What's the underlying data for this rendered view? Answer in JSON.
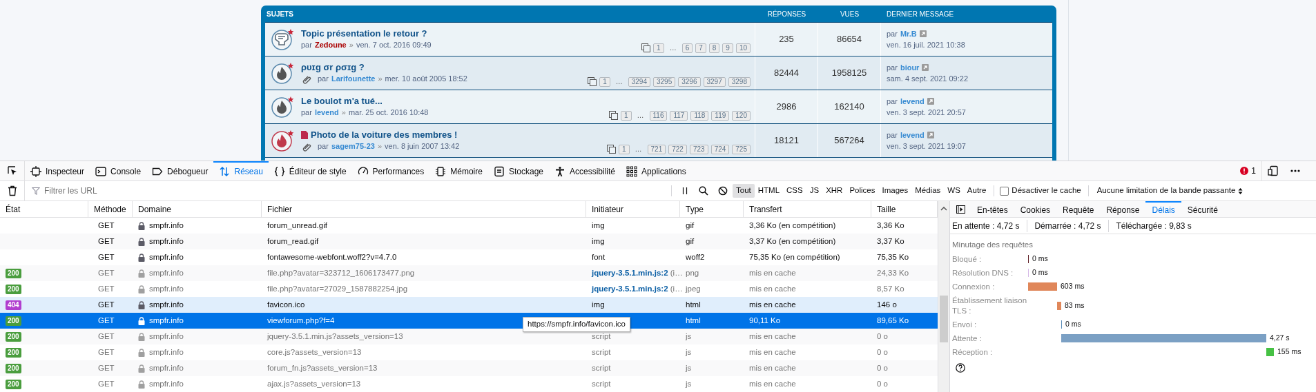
{
  "forum": {
    "header": {
      "topics": "SUJETS",
      "replies": "RÉPONSES",
      "views": "VUES",
      "last": "DERNIER MESSAGE"
    },
    "topics": [
      {
        "kind": "announce",
        "file": false,
        "attachment": false,
        "title": "Topic présentation le retour ?",
        "by": "par",
        "author": {
          "name": "Zedoune",
          "color": "#aa0000"
        },
        "sep": "»",
        "date": "ven. 7 oct. 2016 09:49",
        "pages": {
          "first": "1",
          "ellipsis": "…",
          "last": [
            "6",
            "7",
            "8",
            "9",
            "10"
          ]
        },
        "replies": "235",
        "views": "86654",
        "last_by": "par",
        "last_author": {
          "name": "Mr.B",
          "color": "#368ad2"
        },
        "last_date": "ven. 16 juil. 2021 10:38"
      },
      {
        "kind": "hot",
        "file": false,
        "attachment": true,
        "title": "ρυɪɡ σr ρσɪɡ ?",
        "by": "par",
        "author": {
          "name": "Larifounette",
          "color": "#368ad2"
        },
        "sep": "»",
        "date": "mer. 10 août 2005 18:52",
        "pages": {
          "first": "1",
          "ellipsis": "…",
          "last": [
            "3294",
            "3295",
            "3296",
            "3297",
            "3298"
          ]
        },
        "replies": "82444",
        "views": "1958125",
        "last_by": "par",
        "last_author": {
          "name": "biour",
          "color": "#368ad2"
        },
        "last_date": "sam. 4 sept. 2021 09:22"
      },
      {
        "kind": "hot",
        "file": false,
        "attachment": false,
        "title": "Le boulot m'a tué...",
        "by": "par",
        "author": {
          "name": "levend",
          "color": "#368ad2"
        },
        "sep": "»",
        "date": "mar. 25 oct. 2016 10:48",
        "pages": {
          "first": "1",
          "ellipsis": "…",
          "last": [
            "116",
            "117",
            "118",
            "119",
            "120"
          ]
        },
        "replies": "2986",
        "views": "162140",
        "last_by": "par",
        "last_author": {
          "name": "levend",
          "color": "#368ad2"
        },
        "last_date": "ven. 3 sept. 2021 20:57"
      },
      {
        "kind": "hot_unread",
        "file": true,
        "attachment": true,
        "title": "Photo de la voiture des membres !",
        "by": "par",
        "author": {
          "name": "sagem75-23",
          "color": "#368ad2"
        },
        "sep": "»",
        "date": "ven. 8 juin 2007 13:42",
        "pages": {
          "first": "1",
          "ellipsis": "…",
          "last": [
            "721",
            "722",
            "723",
            "724",
            "725"
          ]
        },
        "replies": "18121",
        "views": "567264",
        "last_by": "par",
        "last_author": {
          "name": "levend",
          "color": "#368ad2"
        },
        "last_date": "ven. 3 sept. 2021 19:07"
      }
    ]
  },
  "devtools": {
    "tools": [
      {
        "kind": "inspector",
        "label": "Inspecteur",
        "selected": false
      },
      {
        "kind": "console",
        "label": "Console",
        "selected": false
      },
      {
        "kind": "debugger",
        "label": "Débogueur",
        "selected": false
      },
      {
        "kind": "network",
        "label": "Réseau",
        "selected": true
      },
      {
        "kind": "style",
        "label": "Éditeur de style",
        "selected": false
      },
      {
        "kind": "performance",
        "label": "Performances",
        "selected": false
      },
      {
        "kind": "memory",
        "label": "Mémoire",
        "selected": false
      },
      {
        "kind": "storage",
        "label": "Stockage",
        "selected": false
      },
      {
        "kind": "accessibility",
        "label": "Accessibilité",
        "selected": false
      },
      {
        "kind": "applications",
        "label": "Applications",
        "selected": false
      }
    ],
    "error_count": "1",
    "filter": {
      "placeholder": "Filtrer les URL"
    },
    "type_filters": [
      {
        "label": "Tout",
        "selected": true
      },
      {
        "label": "HTML",
        "selected": false
      },
      {
        "label": "CSS",
        "selected": false
      },
      {
        "label": "JS",
        "selected": false
      },
      {
        "label": "XHR",
        "selected": false
      },
      {
        "label": "Polices",
        "selected": false
      },
      {
        "label": "Images",
        "selected": false
      },
      {
        "label": "Médias",
        "selected": false
      },
      {
        "label": "WS",
        "selected": false
      },
      {
        "label": "Autre",
        "selected": false
      }
    ],
    "disable_cache": {
      "label": "Désactiver le cache",
      "checked": false
    },
    "throttling": "Aucune limitation de la bande passante",
    "columns": [
      "État",
      "Méthode",
      "Domaine",
      "Fichier",
      "Initiateur",
      "Type",
      "Transfert",
      "Taille"
    ],
    "requests": [
      {
        "method": "GET",
        "domain": "smpfr.info",
        "file": "forum_unread.gif",
        "initiator": "img",
        "type": "gif",
        "transfer": "3,36 Ko (en compétition)",
        "size": "3,36 Ko",
        "cached": false,
        "selected": false,
        "highlighted": false
      },
      {
        "method": "GET",
        "domain": "smpfr.info",
        "file": "forum_read.gif",
        "initiator": "img",
        "type": "gif",
        "transfer": "3,37 Ko (en compétition)",
        "size": "3,37 Ko",
        "cached": false,
        "selected": false,
        "highlighted": false
      },
      {
        "method": "GET",
        "domain": "smpfr.info",
        "file": "fontawesome-webfont.woff2?v=4.7.0",
        "initiator": "font",
        "type": "woff2",
        "transfer": "75,35 Ko (en compétition)",
        "size": "75,35 Ko",
        "cached": false,
        "selected": false,
        "highlighted": false
      },
      {
        "status": {
          "code": "200",
          "color": "#4a9d3e"
        },
        "method": "GET",
        "domain": "smpfr.info",
        "file": "file.php?avatar=323712_1606173477.png",
        "initiator": "**jquery-3.5.1.min.js:2** (i…",
        "type": "png",
        "transfer": "mis en cache",
        "size": "24,33 Ko",
        "cached": true,
        "selected": false,
        "highlighted": false
      },
      {
        "status": {
          "code": "200",
          "color": "#4a9d3e"
        },
        "method": "GET",
        "domain": "smpfr.info",
        "file": "file.php?avatar=27029_1587882254.jpg",
        "initiator": "**jquery-3.5.1.min.js:2** (i…",
        "type": "jpeg",
        "transfer": "mis en cache",
        "size": "8,57 Ko",
        "cached": true,
        "selected": false,
        "highlighted": false
      },
      {
        "status": {
          "code": "404",
          "color": "#b13fcf"
        },
        "method": "GET",
        "domain": "smpfr.info",
        "file": "favicon.ico",
        "initiator": "img",
        "type": "html",
        "transfer": "mis en cache",
        "size": "146 o",
        "cached": false,
        "selected": false,
        "highlighted": true
      },
      {
        "status": {
          "code": "200",
          "color": "#4a9d3e"
        },
        "method": "GET",
        "domain": "smpfr.info",
        "file": "viewforum.php?f=4",
        "type": "html",
        "transfer": "90,11 Ko",
        "size": "89,65 Ko",
        "cached": false,
        "selected": true,
        "highlighted": false
      },
      {
        "status": {
          "code": "200",
          "color": "#4a9d3e"
        },
        "method": "GET",
        "domain": "smpfr.info",
        "file": "jquery-3.5.1.min.js?assets_version=13",
        "initiator": "script",
        "type": "js",
        "transfer": "mis en cache",
        "size": "0 o",
        "cached": true,
        "selected": false,
        "highlighted": false
      },
      {
        "status": {
          "code": "200",
          "color": "#4a9d3e"
        },
        "method": "GET",
        "domain": "smpfr.info",
        "file": "core.js?assets_version=13",
        "initiator": "script",
        "type": "js",
        "transfer": "mis en cache",
        "size": "0 o",
        "cached": true,
        "selected": false,
        "highlighted": false
      },
      {
        "status": {
          "code": "200",
          "color": "#4a9d3e"
        },
        "method": "GET",
        "domain": "smpfr.info",
        "file": "forum_fn.js?assets_version=13",
        "initiator": "script",
        "type": "js",
        "transfer": "mis en cache",
        "size": "0 o",
        "cached": true,
        "selected": false,
        "highlighted": false
      },
      {
        "status": {
          "code": "200",
          "color": "#4a9d3e"
        },
        "method": "GET",
        "domain": "smpfr.info",
        "file": "ajax.js?assets_version=13",
        "initiator": "script",
        "type": "js",
        "transfer": "mis en cache",
        "size": "0 o",
        "cached": true,
        "selected": false,
        "highlighted": false
      }
    ],
    "tooltip": "https://smpfr.info/favicon.ico",
    "details": {
      "tabs": [
        {
          "label": "En-têtes",
          "selected": false
        },
        {
          "label": "Cookies",
          "selected": false
        },
        {
          "label": "Requête",
          "selected": false
        },
        {
          "label": "Réponse",
          "selected": false
        },
        {
          "label": "Délais",
          "selected": true
        },
        {
          "label": "Sécurité",
          "selected": false
        }
      ],
      "summary": [
        "En attente : 4,72 s",
        "Démarrée : 4,72 s",
        "Téléchargée : 9,83 s"
      ],
      "section": "Minutage des requêtes",
      "timings": [
        {
          "label": "Bloqué :",
          "reading": "0 ms",
          "color": "#5e1d24"
        },
        {
          "label": "Résolution DNS :",
          "reading": "0 ms",
          "color": "#d5b8e6"
        },
        {
          "label": "Connexion :",
          "reading": "603 ms",
          "color": "#e0875a"
        },
        {
          "label": "Établissement liaison TLS :",
          "reading": "83 ms",
          "color": "#e0875a"
        },
        {
          "label": "Envoi :",
          "reading": "0 ms",
          "color": "#5b8db8"
        },
        {
          "label": "Attente :",
          "reading": "4,27 s",
          "color": "#7ba0c4"
        },
        {
          "label": "Réception :",
          "reading": "155 ms",
          "color": "#46c144"
        }
      ]
    }
  }
}
